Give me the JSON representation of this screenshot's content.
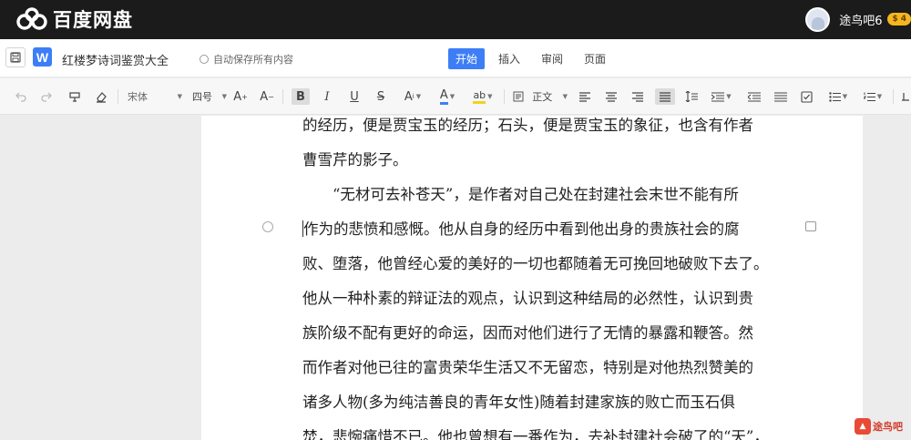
{
  "app": {
    "name": "百度网盘",
    "user": "途鸟吧6",
    "vip_level": "4"
  },
  "doc": {
    "title": "红楼梦诗词鉴赏大全",
    "autosave_text": "自动保存所有内容"
  },
  "tabs": [
    {
      "label": "开始",
      "active": true
    },
    {
      "label": "插入",
      "active": false
    },
    {
      "label": "审阅",
      "active": false
    },
    {
      "label": "页面",
      "active": false
    }
  ],
  "toolbar": {
    "font": "宋体",
    "size": "四号",
    "paragraph_style": "正文",
    "icons": [
      "undo-icon",
      "redo-icon",
      "format-painter-icon",
      "clear-format-icon",
      "font-grow-icon",
      "font-shrink-icon",
      "bold-icon",
      "italic-icon",
      "underline-icon",
      "strikethrough-icon",
      "superscript-icon",
      "font-color-icon",
      "highlight-icon",
      "align-left-icon",
      "align-center-icon",
      "align-right-icon",
      "justify-icon",
      "line-spacing-icon",
      "indent-icon",
      "outdent-icon",
      "checkbox-icon",
      "bullet-list-icon",
      "numbered-list-icon"
    ]
  },
  "content": {
    "lines": [
      "的经历，便是贾宝玉的经历；石头，便是贾宝玉的象征，也含有作者",
      "曹雪芹的影子。",
      "　　“无材可去补苍天”，是作者对自己处在封建社会末世不能有所",
      "作为的悲愤和感慨。他从自身的经历中看到他出身的贵族社会的腐",
      "败、堕落，他曾经心爱的美好的一切也都随着无可挽回地破败下去了。",
      "他从一种朴素的辩证法的观点，认识到这种结局的必然性，认识到贵",
      "族阶级不配有更好的命运，因而对他们进行了无情的暴露和鞭答。然",
      "而作者对他已往的富贵荣华生活又不无留恋，特别是对他热烈赞美的",
      "诸多人物(多为纯洁善良的青年女性)随着封建家族的败亡而玉石俱",
      "焚，悲惋痛惜不已。他也曾想有一番作为，去补封建社会破了的“天”，"
    ]
  },
  "watermark": {
    "text": "途鸟吧"
  },
  "colors": {
    "topbar": "#1b1b1b",
    "accent": "#3d7ef7",
    "vip": "#f3b61f"
  }
}
